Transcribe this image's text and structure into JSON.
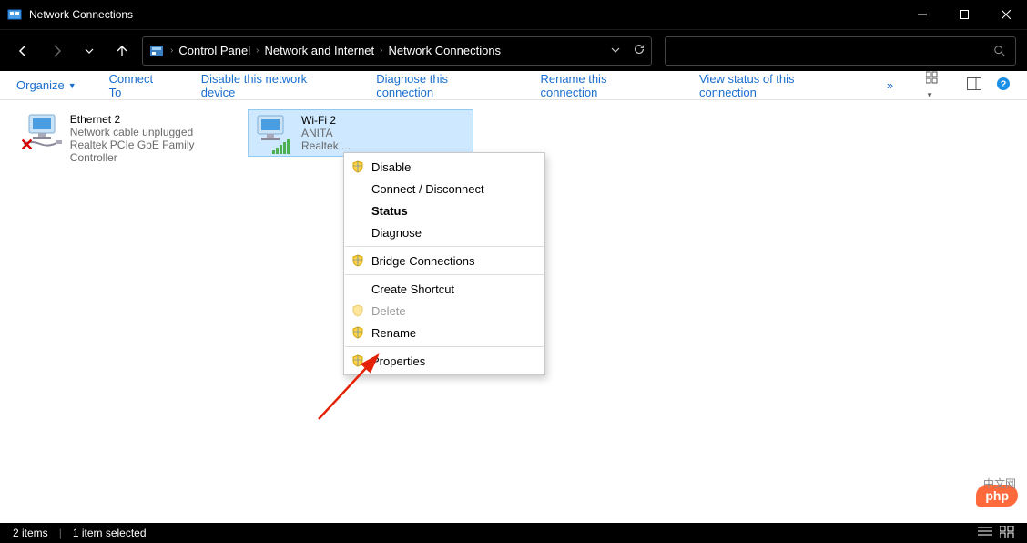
{
  "window": {
    "title": "Network Connections"
  },
  "breadcrumbs": {
    "root": "Control Panel",
    "mid": "Network and Internet",
    "leaf": "Network Connections"
  },
  "toolbar": {
    "organize": "Organize",
    "connect_to": "Connect To",
    "disable": "Disable this network device",
    "diagnose": "Diagnose this connection",
    "rename": "Rename this connection",
    "view_status": "View status of this connection",
    "overflow": "»"
  },
  "adapters": {
    "ethernet": {
      "name": "Ethernet 2",
      "status": "Network cable unplugged",
      "device": "Realtek PCIe GbE Family Controller"
    },
    "wifi": {
      "name": "Wi-Fi 2",
      "status": "ANITA",
      "device": "Realtek ..."
    }
  },
  "context_menu": {
    "disable": "Disable",
    "connect_disconnect": "Connect / Disconnect",
    "status": "Status",
    "diagnose": "Diagnose",
    "bridge": "Bridge Connections",
    "create_shortcut": "Create Shortcut",
    "delete": "Delete",
    "rename": "Rename",
    "properties": "Properties"
  },
  "statusbar": {
    "items": "2 items",
    "selected": "1 item selected"
  },
  "badge": {
    "pill": "php",
    "text": "中文网"
  }
}
